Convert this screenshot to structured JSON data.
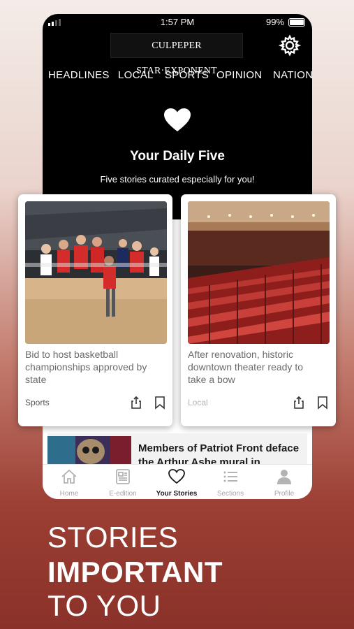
{
  "status_bar": {
    "time": "1:57 PM",
    "battery": "99%"
  },
  "header": {
    "logo_text": "CULPEPER STAR·EXPONENT",
    "settings_icon": "gear-icon"
  },
  "nav_tabs": [
    "HEADLINES",
    "LOCAL",
    "SPORTS",
    "OPINION",
    "NATION"
  ],
  "daily_five": {
    "icon": "heart-icon",
    "title": "Your Daily Five",
    "subtitle": "Five stories curated especially for you!"
  },
  "cards": [
    {
      "headline": "Bid to host basketball championships approved by state",
      "section": "Sports",
      "image": "basketball-players-photo",
      "section_color": "#555555"
    },
    {
      "headline": "After renovation, historic downtown theater ready to take a bow",
      "section": "Local",
      "image": "theater-seats-photo",
      "section_color": "#b3b3b3"
    }
  ],
  "article_preview": {
    "title": "Members of Patriot Front deface the Arthur Ashe mural in",
    "image": "mural-photo"
  },
  "bottom_nav": [
    {
      "label": "Home",
      "icon": "home-icon",
      "active": false
    },
    {
      "label": "E-edition",
      "icon": "newspaper-icon",
      "active": false
    },
    {
      "label": "Your Stories",
      "icon": "heart-outline-icon",
      "active": true
    },
    {
      "label": "Sections",
      "icon": "list-icon",
      "active": false
    },
    {
      "label": "Profile",
      "icon": "person-icon",
      "active": false
    }
  ],
  "tagline": {
    "line1": "STORIES",
    "line2": "IMPORTANT",
    "line3": "TO YOU"
  },
  "colors": {
    "accent_red": "#c0302e",
    "background_dark": "#000000",
    "marketing_red": "#8a3129"
  }
}
